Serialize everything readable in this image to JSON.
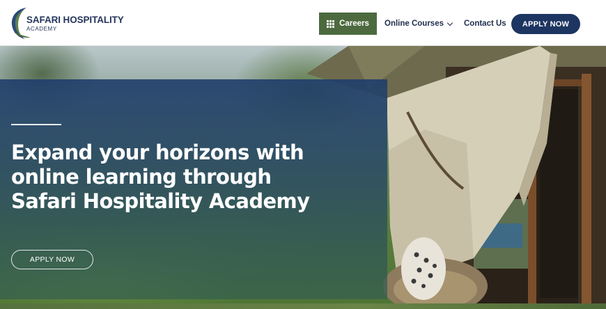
{
  "header": {
    "logo": {
      "name": "SAFARI HOSPITALITY",
      "subtitle": "ACADEMY",
      "icon": "crescent-logo-icon"
    },
    "nav": {
      "careers": {
        "label": "Careers",
        "icon": "grid-icon"
      },
      "online_courses": {
        "label": "Online Courses",
        "icon": "chevron-down-icon"
      },
      "contact": {
        "label": "Contact Us"
      }
    },
    "apply_button": "APPLY NOW"
  },
  "hero": {
    "title": "Expand your horizons with online learning through Safari Hospitality Academy",
    "apply_button": "APPLY NOW"
  },
  "colors": {
    "brand_navy": "#1d3561",
    "brand_green": "#4d6a3f",
    "overlay": "#1f3e6b"
  }
}
